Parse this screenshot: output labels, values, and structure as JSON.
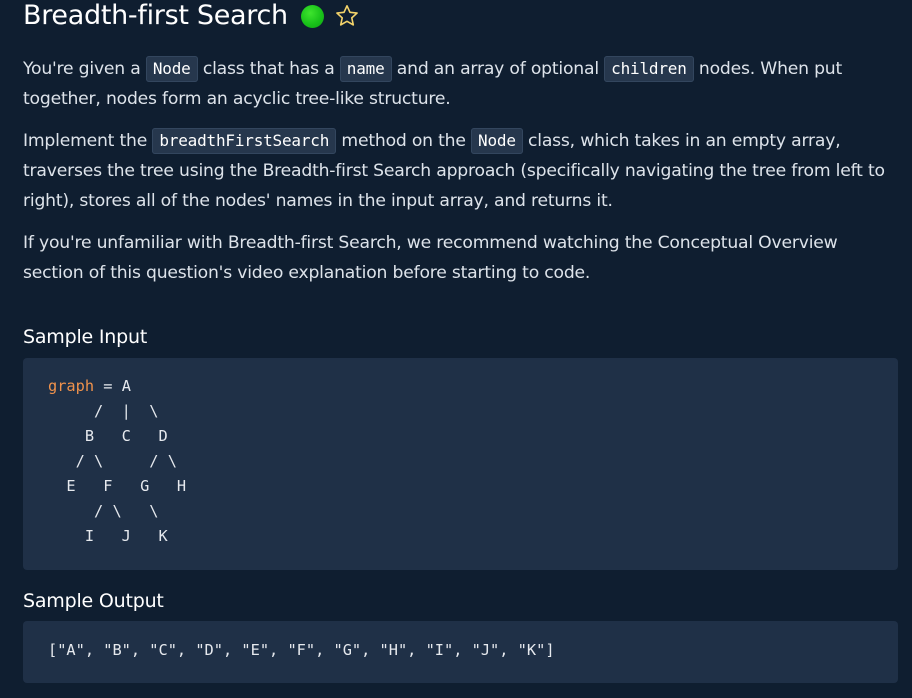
{
  "title": "Breadth-first Search",
  "status_color": "#21c11f",
  "star_icon": "star-outline-icon",
  "paragraph1": {
    "t1": "You're given a ",
    "c1": "Node",
    "t2": " class that has a ",
    "c2": "name",
    "t3": " and an array of optional ",
    "c3": "children",
    "t4": " nodes. When put together, nodes form an acyclic tree-like structure."
  },
  "paragraph2": {
    "t1": "Implement the ",
    "c1": "breadthFirstSearch",
    "t2": " method on the ",
    "c2": "Node",
    "t3": " class, which takes in an empty array, traverses the tree using the Breadth-first Search approach (specifically navigating the tree from left to right), stores all of the nodes' names in the input array, and returns it."
  },
  "paragraph3": "If you're unfamiliar with Breadth-first Search, we recommend watching the Conceptual Overview section of this question's video explanation before starting to code.",
  "sample_input": {
    "heading": "Sample Input",
    "var_name": "graph",
    "lines": [
      " = A",
      "     /  |  \\",
      "    B   C   D",
      "   / \\     / \\",
      "  E   F   G   H",
      "     / \\   \\",
      "    I   J   K"
    ]
  },
  "sample_output": {
    "heading": "Sample Output",
    "value": "[\"A\", \"B\", \"C\", \"D\", \"E\", \"F\", \"G\", \"H\", \"I\", \"J\", \"K\"]"
  }
}
